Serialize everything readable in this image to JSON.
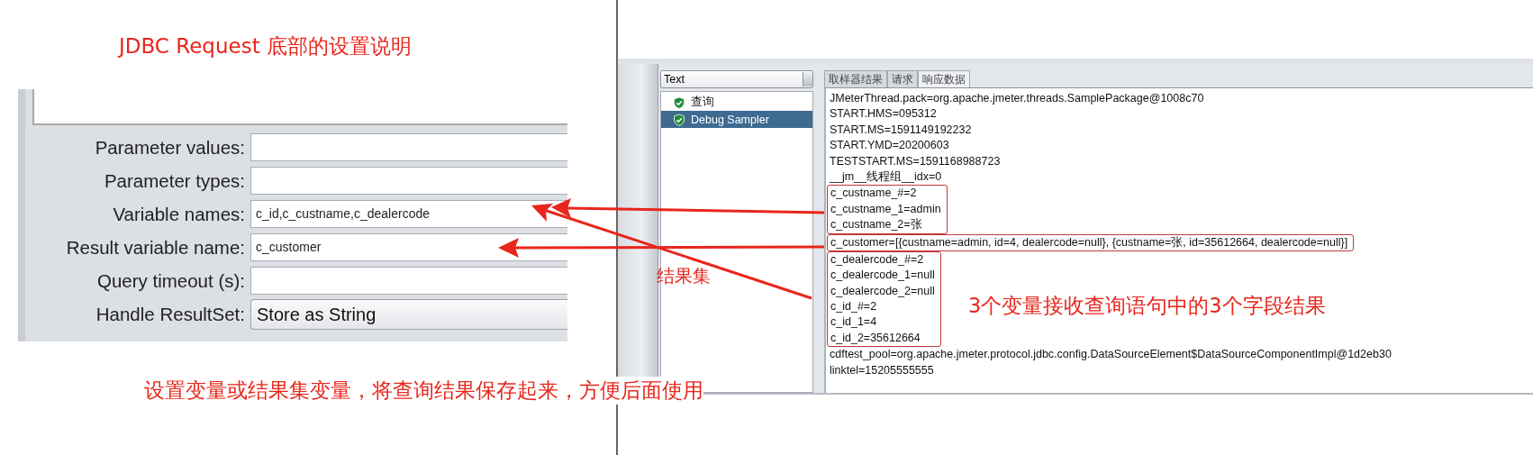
{
  "annotations": {
    "title": "JDBC Request 底部的设置说明",
    "result_set_label": "结果集",
    "fields_note": "3个变量接收查询语句中的3个字段结果",
    "bottom_note": "设置变量或结果集变量，将查询结果保存起来，方便后面使用"
  },
  "form": {
    "rows": [
      {
        "label": "Parameter values:",
        "value": "",
        "kind": "field"
      },
      {
        "label": "Parameter types:",
        "value": "",
        "kind": "field"
      },
      {
        "label": "Variable names:",
        "value": "c_id,c_custname,c_dealercode",
        "kind": "field"
      },
      {
        "label": "Result variable name:",
        "value": "c_customer",
        "kind": "field"
      },
      {
        "label": "Query timeout (s):",
        "value": "",
        "kind": "field"
      },
      {
        "label": "Handle ResultSet:",
        "value": "Store as String",
        "kind": "select"
      }
    ]
  },
  "results": {
    "renderer": "Text",
    "tree": [
      {
        "label": "查询",
        "selected": false
      },
      {
        "label": "Debug Sampler",
        "selected": true
      }
    ],
    "tabs": [
      {
        "label": "取样器结果",
        "selected": false
      },
      {
        "label": "请求",
        "selected": false
      },
      {
        "label": "响应数据",
        "selected": true
      }
    ],
    "blocks": [
      {
        "highlighted": false,
        "lines": [
          "JMeterThread.pack=org.apache.jmeter.threads.SamplePackage@1008c70",
          "START.HMS=095312",
          "START.MS=1591149192232",
          "START.YMD=20200603",
          "TESTSTART.MS=1591168988723",
          "__jm__线程组__idx=0"
        ]
      },
      {
        "highlighted": true,
        "lines": [
          "c_custname_#=2",
          "c_custname_1=admin",
          "c_custname_2=张"
        ]
      },
      {
        "highlighted": true,
        "lines": [
          "c_customer=[{custname=admin, id=4, dealercode=null}, {custname=张, id=35612664, dealercode=null}]"
        ]
      },
      {
        "highlighted": true,
        "lines": [
          "c_dealercode_#=2",
          "c_dealercode_1=null",
          "c_dealercode_2=null",
          "c_id_#=2",
          "c_id_1=4",
          "c_id_2=35612664"
        ]
      },
      {
        "highlighted": false,
        "lines": [
          "cdftest_pool=org.apache.jmeter.protocol.jdbc.config.DataSourceElement$DataSourceComponentImpl@1d2eb30",
          "linktel=15205555555"
        ]
      }
    ]
  }
}
